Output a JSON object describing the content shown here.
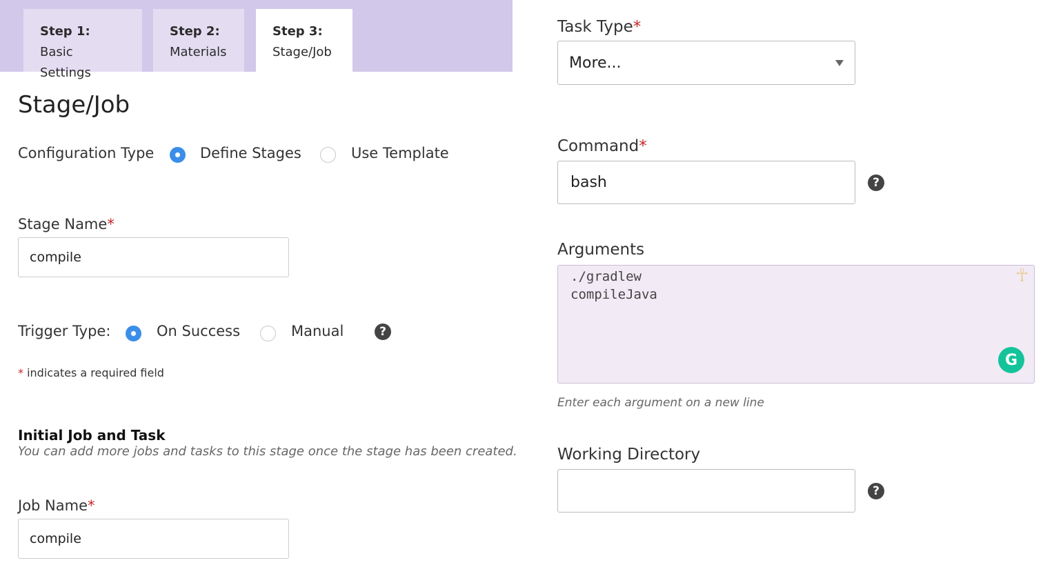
{
  "tabs": [
    {
      "number": "Step 1:",
      "label": "Basic Settings"
    },
    {
      "number": "Step 2:",
      "label": "Materials"
    },
    {
      "number": "Step 3:",
      "label": "Stage/Job"
    }
  ],
  "page_title": "Stage/Job",
  "configuration_type": {
    "label": "Configuration Type",
    "options": [
      "Define Stages",
      "Use Template"
    ],
    "selected": "Define Stages"
  },
  "stage_name": {
    "label": "Stage Name",
    "required_mark": "*",
    "value": "compile"
  },
  "trigger_type": {
    "label": "Trigger Type:",
    "options": [
      "On Success",
      "Manual"
    ],
    "selected": "On Success",
    "help_glyph": "?"
  },
  "required_note": {
    "mark": "*",
    "text": " indicates a required field"
  },
  "initial_job": {
    "heading": "Initial Job and Task",
    "subtext": "You can add more jobs and tasks to this stage once the stage has been created."
  },
  "job_name": {
    "label": "Job Name",
    "required_mark": "*",
    "value": "compile"
  },
  "task_type": {
    "label": "Task Type",
    "required_mark": "*",
    "value": "More..."
  },
  "command": {
    "label": "Command",
    "required_mark": "*",
    "value": "bash",
    "help_glyph": "?"
  },
  "arguments": {
    "label": "Arguments",
    "value": "./gradlew\ncompileJava",
    "hint": "Enter each argument on a new line",
    "grammarly_glyph": "G",
    "extension_glyph": "☥"
  },
  "working_directory": {
    "label": "Working Directory",
    "value": "",
    "help_glyph": "?"
  },
  "colors": {
    "tab_bar": "#d2c8ea",
    "tab_inactive": "#e4ddf2",
    "radio_checked": "#3b8ee8",
    "required": "#c4272c",
    "textarea_bg": "#f2eaf5",
    "grammarly": "#15c39a"
  },
  "icons": [
    "help-icon",
    "dropdown-arrow-icon",
    "grammarly-icon",
    "ankh-extension-icon"
  ]
}
